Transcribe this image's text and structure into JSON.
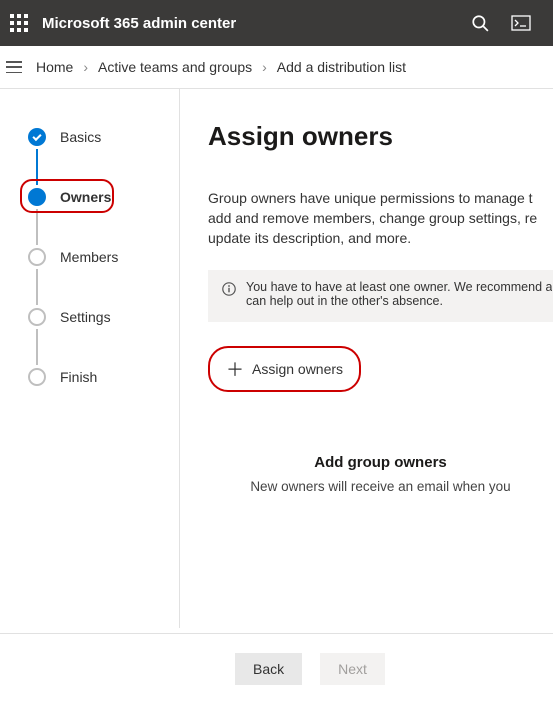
{
  "topbar": {
    "title": "Microsoft 365 admin center"
  },
  "breadcrumb": {
    "items": [
      "Home",
      "Active teams and groups",
      "Add a distribution list"
    ]
  },
  "steps": [
    {
      "label": "Basics",
      "state": "completed"
    },
    {
      "label": "Owners",
      "state": "active",
      "highlighted": true
    },
    {
      "label": "Members",
      "state": "pending"
    },
    {
      "label": "Settings",
      "state": "pending"
    },
    {
      "label": "Finish",
      "state": "pending"
    }
  ],
  "main": {
    "title": "Assign owners",
    "desc1": "Group owners have unique permissions to manage t",
    "desc2": "add and remove members, change group settings, re",
    "desc3": "update its description, and more.",
    "info1": "You have to have at least one owner. We recommend a",
    "info2": "can help out in the other's absence.",
    "assign_btn": "Assign owners",
    "subhead": "Add group owners",
    "subtext": "New owners will receive an email when you"
  },
  "footer": {
    "back": "Back",
    "next": "Next"
  }
}
